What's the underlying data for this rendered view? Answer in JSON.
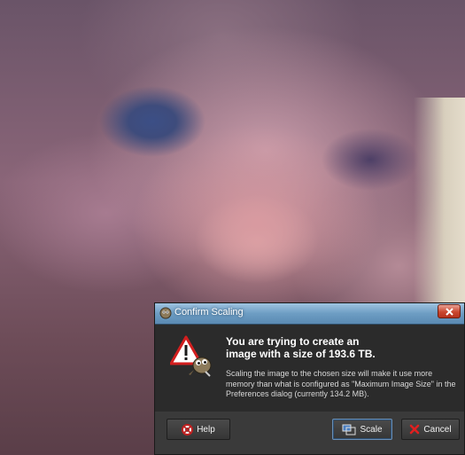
{
  "dialog": {
    "title": "Confirm Scaling",
    "heading": "You are trying to create an image with a size of 193.6 TB.",
    "message": "Scaling the image to the chosen size will make it use more memory than what is configured as \"Maximum Image Size\" in the Preferences dialog (currently 134.2 MB).",
    "buttons": {
      "help": "Help",
      "scale": "Scale",
      "cancel": "Cancel"
    }
  },
  "icons": {
    "title": "gimp-icon",
    "warning": "warning-icon",
    "close": "close-icon",
    "help": "help-icon",
    "scale": "scale-icon",
    "cancel": "cancel-icon"
  },
  "colors": {
    "titlebar": "#6d9dc3",
    "dialog_bg": "#2b2b2b",
    "close": "#c9472f",
    "warning_red": "#d21e1e",
    "cancel_red": "#e02020"
  }
}
